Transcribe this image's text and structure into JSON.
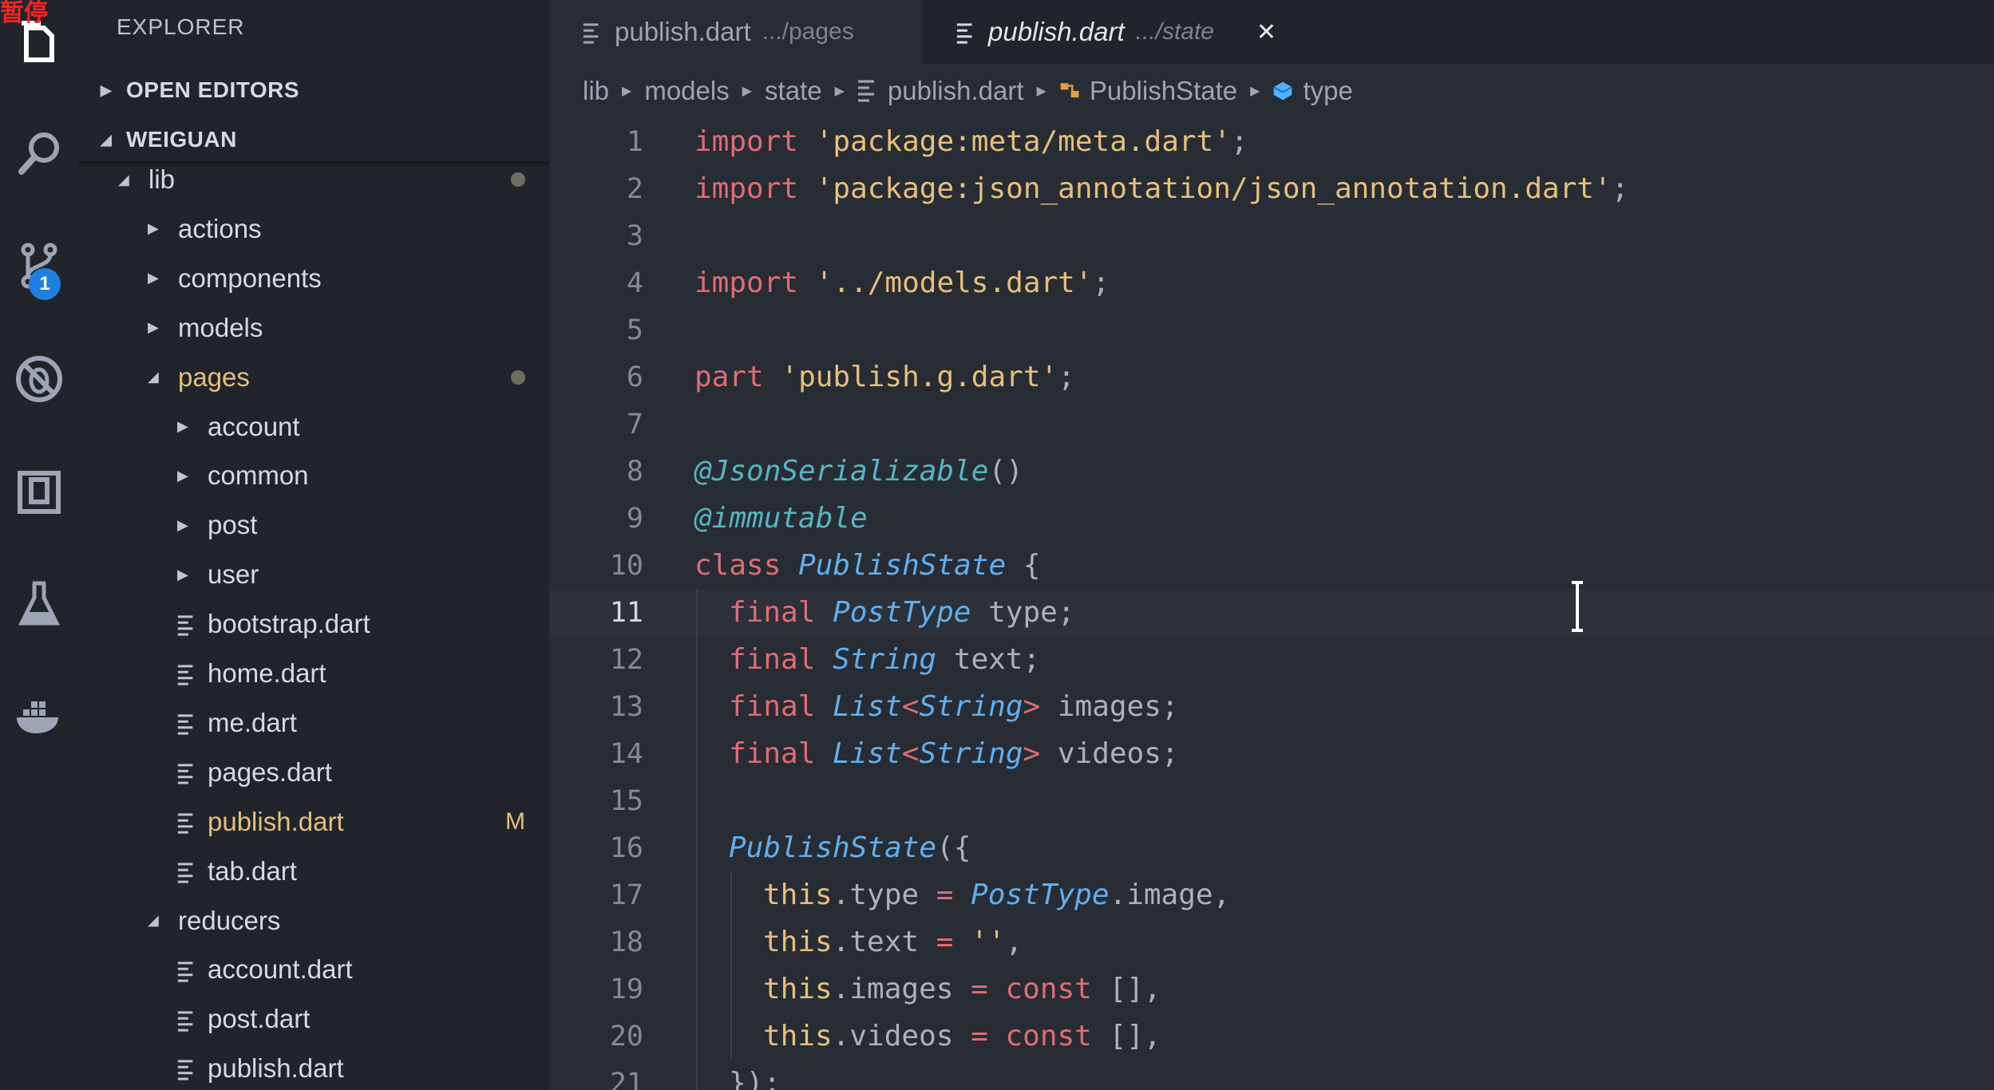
{
  "overlay": {
    "pause_label": "暂停"
  },
  "activity_bar": {
    "icons": [
      "files-icon",
      "search-icon",
      "source-control-icon",
      "debug-icon",
      "extensions-icon",
      "flask-icon",
      "docker-icon"
    ],
    "source_control_badge": "1"
  },
  "sidebar": {
    "title": "EXPLORER",
    "sections": {
      "open_editors": "OPEN EDITORS",
      "workspace": "WEIGUAN"
    },
    "tree": [
      {
        "label": "lib",
        "type": "folder-open",
        "depth": 0,
        "dot": true
      },
      {
        "label": "actions",
        "type": "folder",
        "depth": 1
      },
      {
        "label": "components",
        "type": "folder",
        "depth": 1
      },
      {
        "label": "models",
        "type": "folder",
        "depth": 1
      },
      {
        "label": "pages",
        "type": "folder-open",
        "depth": 1,
        "dot": true,
        "modified": true
      },
      {
        "label": "account",
        "type": "folder",
        "depth": 2
      },
      {
        "label": "common",
        "type": "folder",
        "depth": 2
      },
      {
        "label": "post",
        "type": "folder",
        "depth": 2
      },
      {
        "label": "user",
        "type": "folder",
        "depth": 2
      },
      {
        "label": "bootstrap.dart",
        "type": "file",
        "depth": 2
      },
      {
        "label": "home.dart",
        "type": "file",
        "depth": 2
      },
      {
        "label": "me.dart",
        "type": "file",
        "depth": 2
      },
      {
        "label": "pages.dart",
        "type": "file",
        "depth": 2
      },
      {
        "label": "publish.dart",
        "type": "file",
        "depth": 2,
        "modified": true,
        "flag": "M"
      },
      {
        "label": "tab.dart",
        "type": "file",
        "depth": 2
      },
      {
        "label": "reducers",
        "type": "folder-open",
        "depth": 1
      },
      {
        "label": "account.dart",
        "type": "file",
        "depth": 2
      },
      {
        "label": "post.dart",
        "type": "file",
        "depth": 2
      },
      {
        "label": "publish.dart",
        "type": "file",
        "depth": 2
      }
    ]
  },
  "tabs": [
    {
      "name": "publish.dart",
      "path": ".../pages",
      "active": false
    },
    {
      "name": "publish.dart",
      "path": ".../state",
      "active": true,
      "close": "✕"
    }
  ],
  "breadcrumb": [
    "lib",
    "models",
    "state",
    "publish.dart",
    "PublishState",
    "type"
  ],
  "editor": {
    "active_line": 11,
    "lines": [
      {
        "n": "1",
        "indent": 0,
        "tokens": [
          [
            "k",
            "import"
          ],
          [
            "p",
            " "
          ],
          [
            "s",
            "'package:meta/meta.dart'"
          ],
          [
            "p",
            ";"
          ]
        ]
      },
      {
        "n": "2",
        "indent": 0,
        "tokens": [
          [
            "k",
            "import"
          ],
          [
            "p",
            " "
          ],
          [
            "s",
            "'package:json_annotation/json_annotation.dart'"
          ],
          [
            "p",
            ";"
          ]
        ]
      },
      {
        "n": "3",
        "indent": 0,
        "tokens": []
      },
      {
        "n": "4",
        "indent": 0,
        "tokens": [
          [
            "k",
            "import"
          ],
          [
            "p",
            " "
          ],
          [
            "s",
            "'../models.dart'"
          ],
          [
            "p",
            ";"
          ]
        ]
      },
      {
        "n": "5",
        "indent": 0,
        "tokens": []
      },
      {
        "n": "6",
        "indent": 0,
        "tokens": [
          [
            "k",
            "part"
          ],
          [
            "p",
            " "
          ],
          [
            "s",
            "'publish.g.dart'"
          ],
          [
            "p",
            ";"
          ]
        ]
      },
      {
        "n": "7",
        "indent": 0,
        "tokens": []
      },
      {
        "n": "8",
        "indent": 0,
        "tokens": [
          [
            "a",
            "@JsonSerializable"
          ],
          [
            "p",
            "()"
          ]
        ]
      },
      {
        "n": "9",
        "indent": 0,
        "tokens": [
          [
            "a",
            "@immutable"
          ]
        ]
      },
      {
        "n": "10",
        "indent": 0,
        "tokens": [
          [
            "k",
            "class"
          ],
          [
            "p",
            " "
          ],
          [
            "t",
            "PublishState"
          ],
          [
            "p",
            " {"
          ]
        ]
      },
      {
        "n": "11",
        "indent": 1,
        "tokens": [
          [
            "k",
            "final"
          ],
          [
            "p",
            " "
          ],
          [
            "t",
            "PostType"
          ],
          [
            "p",
            " type;"
          ]
        ]
      },
      {
        "n": "12",
        "indent": 1,
        "tokens": [
          [
            "k",
            "final"
          ],
          [
            "p",
            " "
          ],
          [
            "t",
            "String"
          ],
          [
            "p",
            " text;"
          ]
        ]
      },
      {
        "n": "13",
        "indent": 1,
        "tokens": [
          [
            "k",
            "final"
          ],
          [
            "p",
            " "
          ],
          [
            "t",
            "List"
          ],
          [
            "o",
            "<"
          ],
          [
            "t",
            "String"
          ],
          [
            "o",
            ">"
          ],
          [
            "p",
            " images;"
          ]
        ]
      },
      {
        "n": "14",
        "indent": 1,
        "tokens": [
          [
            "k",
            "final"
          ],
          [
            "p",
            " "
          ],
          [
            "t",
            "List"
          ],
          [
            "o",
            "<"
          ],
          [
            "t",
            "String"
          ],
          [
            "o",
            ">"
          ],
          [
            "p",
            " videos;"
          ]
        ]
      },
      {
        "n": "15",
        "indent": 1,
        "tokens": []
      },
      {
        "n": "16",
        "indent": 1,
        "tokens": [
          [
            "t",
            "PublishState"
          ],
          [
            "p",
            "({"
          ]
        ]
      },
      {
        "n": "17",
        "indent": 2,
        "tokens": [
          [
            "th",
            "this"
          ],
          [
            "p",
            ".type "
          ],
          [
            "o",
            "="
          ],
          [
            "p",
            " "
          ],
          [
            "t",
            "PostType"
          ],
          [
            "p",
            ".image,"
          ]
        ]
      },
      {
        "n": "18",
        "indent": 2,
        "tokens": [
          [
            "th",
            "this"
          ],
          [
            "p",
            ".text "
          ],
          [
            "o",
            "="
          ],
          [
            "p",
            " "
          ],
          [
            "s",
            "''"
          ],
          [
            "p",
            ","
          ]
        ]
      },
      {
        "n": "19",
        "indent": 2,
        "tokens": [
          [
            "th",
            "this"
          ],
          [
            "p",
            ".images "
          ],
          [
            "o",
            "="
          ],
          [
            "p",
            " "
          ],
          [
            "k",
            "const"
          ],
          [
            "p",
            " [],"
          ]
        ]
      },
      {
        "n": "20",
        "indent": 2,
        "tokens": [
          [
            "th",
            "this"
          ],
          [
            "p",
            ".videos "
          ],
          [
            "o",
            "="
          ],
          [
            "p",
            " "
          ],
          [
            "k",
            "const"
          ],
          [
            "p",
            " [],"
          ]
        ]
      },
      {
        "n": "21",
        "indent": 1,
        "tokens": [
          [
            "p",
            "});"
          ]
        ]
      }
    ]
  }
}
